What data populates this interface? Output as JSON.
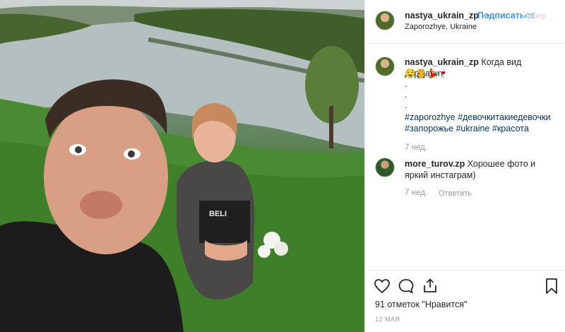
{
  "post": {
    "username": "nastya_ukrain_zp",
    "follow_label": "Подписаться",
    "separator": "•",
    "location": "Zaporozhye, Ukraine",
    "watermark": "Ла6ер"
  },
  "caption": {
    "username": "nastya_ukrain_zp",
    "text": "Когда вид дурманит",
    "emoji": "🤤👸💃🍷",
    "dots": [
      ".",
      ".",
      "."
    ],
    "hashtags_line1": [
      "#zaporozhye",
      "#девочкитакиедевочки"
    ],
    "hashtags_line2": [
      "#запорожье",
      "#ukraine",
      "#красота"
    ],
    "time": "7 нед."
  },
  "comment": {
    "username": "more_turov.zp",
    "text_line1": "Хорошее фото и",
    "text_line2": "яркий инстаграм)",
    "time": "7 нед.",
    "reply_label": "Ответить"
  },
  "footer": {
    "likes": "91 отметок \"Нравится\"",
    "date": "12 МАЯ"
  },
  "icons": {
    "like": "heart-icon",
    "comment": "comment-bubble-icon",
    "share": "share-icon",
    "save": "bookmark-icon"
  },
  "colors": {
    "link": "#3897f0",
    "hashtag": "#003569",
    "muted": "#999999",
    "text": "#262626"
  }
}
